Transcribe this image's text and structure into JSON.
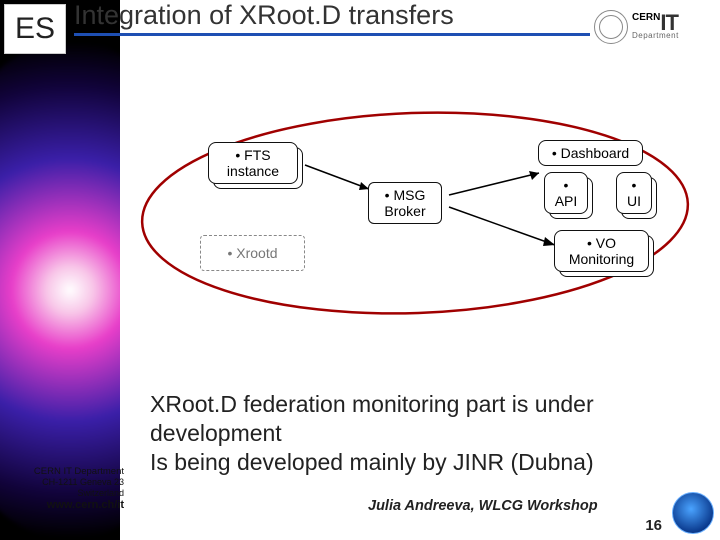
{
  "header": {
    "es_badge": "ES",
    "title": "Integration of XRoot.D transfers",
    "logo_it": "IT",
    "logo_cern": "CERN",
    "logo_dept": "Department"
  },
  "diagram": {
    "fts": "• FTS instance",
    "msg": "• MSG Broker",
    "dashboard": "• Dashboard",
    "api": "• API",
    "ui": "• UI",
    "vo": "• VO Monitoring",
    "xrootd": "• Xrootd"
  },
  "body": {
    "text": "XRoot.D federation monitoring part is under development\nIs being developed mainly by JINR (Dubna)"
  },
  "footer": {
    "addr_line1": "CERN IT Department",
    "addr_line2": "CH-1211 Geneva 23",
    "addr_line3": "Switzerland",
    "url": "www.cern.ch/it",
    "author": "Julia Andreeva, WLCG Workshop",
    "page": "16"
  }
}
